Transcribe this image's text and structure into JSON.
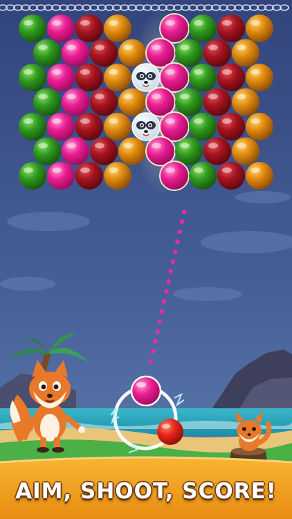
{
  "banner": {
    "text": "AIM, SHOOT, SCORE!"
  },
  "colors": {
    "pink": "#e8178f",
    "red": "#a8121e",
    "green": "#2f9a1e",
    "orange": "#e08a0e",
    "sky_top": "#3a4d86",
    "sky_bottom": "#4f6fa2",
    "banner": "#f3a11c"
  },
  "board": {
    "rows": [
      [
        "green",
        "pink",
        "red",
        "orange",
        "empty",
        "pink",
        "green",
        "red",
        "orange"
      ],
      [
        "green",
        "pink",
        "red",
        "orange",
        "pink",
        "green",
        "red",
        "orange"
      ],
      [
        "green",
        "pink",
        "red",
        "orange",
        "raccoon",
        "pink",
        "green",
        "red",
        "orange"
      ],
      [
        "green",
        "pink",
        "red",
        "orange",
        "pink",
        "green",
        "red",
        "orange"
      ],
      [
        "green",
        "pink",
        "red",
        "orange",
        "raccoon",
        "pink",
        "green",
        "red",
        "orange"
      ],
      [
        "green",
        "pink",
        "red",
        "orange",
        "pink",
        "green",
        "red",
        "orange"
      ],
      [
        "green",
        "pink",
        "red",
        "orange",
        "empty",
        "pink",
        "green",
        "red",
        "orange"
      ]
    ]
  },
  "shooter": {
    "current_bubble": "pink",
    "next_bubble": "red"
  },
  "icons": [
    "chain-icon",
    "fox-mascot",
    "fox-pup",
    "raccoon-bubble",
    "palm-tree",
    "tree-stump"
  ]
}
